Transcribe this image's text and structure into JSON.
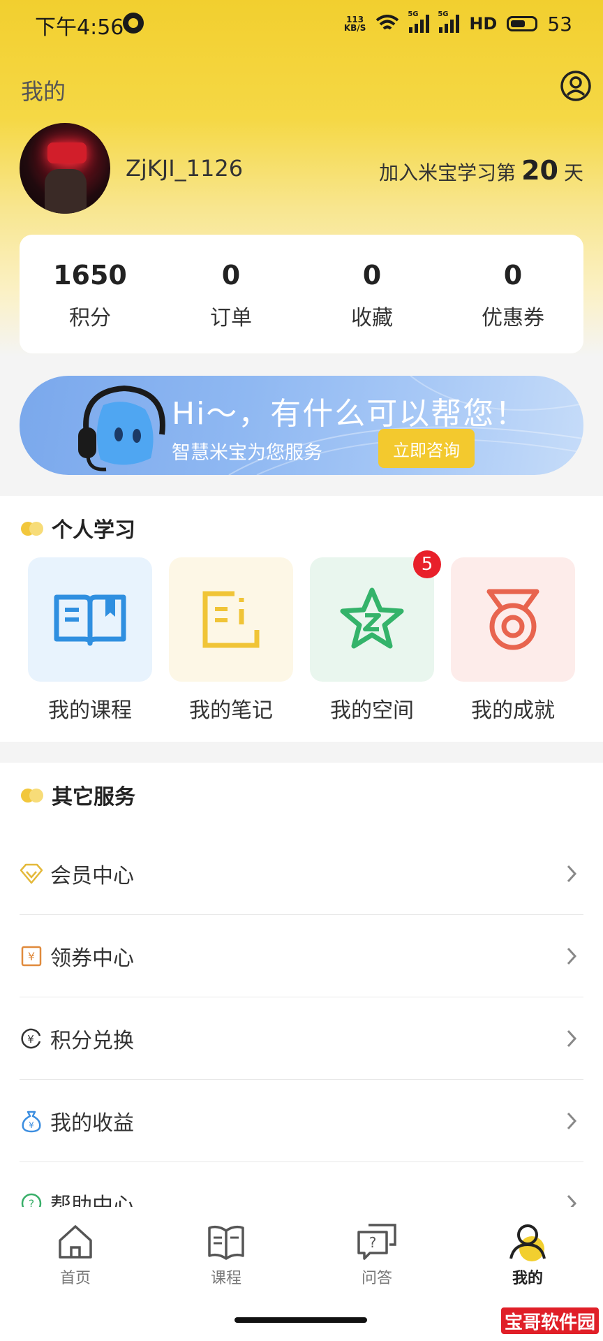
{
  "status_bar": {
    "time": "下午4:56",
    "net_speed_value": "113",
    "net_speed_unit": "KB/S",
    "signal1_label": "5G",
    "signal2_label": "5G",
    "hd_label": "HD",
    "battery": "53"
  },
  "header": {
    "title": "我的",
    "username": "ZjKJI_1126",
    "join_prefix": "加入米宝学习第",
    "join_days": "20",
    "join_suffix": "天"
  },
  "stats": [
    {
      "value": "1650",
      "label": "积分"
    },
    {
      "value": "0",
      "label": "订单"
    },
    {
      "value": "0",
      "label": "收藏"
    },
    {
      "value": "0",
      "label": "优惠券"
    }
  ],
  "banner": {
    "headline": "Hi～，有什么可以帮您！",
    "subtitle": "智慧米宝为您服务",
    "button": "立即咨询"
  },
  "learning": {
    "title": "个人学习",
    "items": [
      {
        "label": "我的课程",
        "icon": "book-icon",
        "color": "#2f8fe0"
      },
      {
        "label": "我的笔记",
        "icon": "note-icon",
        "color": "#f0c437"
      },
      {
        "label": "我的空间",
        "icon": "star-z-icon",
        "color": "#34b36a",
        "badge": "5"
      },
      {
        "label": "我的成就",
        "icon": "medal-icon",
        "color": "#e8644e"
      }
    ]
  },
  "services": {
    "title": "其它服务",
    "items": [
      {
        "label": "会员中心",
        "icon": "diamond-icon"
      },
      {
        "label": "领券中心",
        "icon": "coupon-icon"
      },
      {
        "label": "积分兑换",
        "icon": "exchange-icon"
      },
      {
        "label": "我的收益",
        "icon": "money-bag-icon"
      },
      {
        "label": "帮助中心",
        "icon": "help-icon"
      }
    ]
  },
  "tabbar": [
    {
      "label": "首页",
      "icon": "home-icon"
    },
    {
      "label": "课程",
      "icon": "book-tab-icon"
    },
    {
      "label": "问答",
      "icon": "qa-icon"
    },
    {
      "label": "我的",
      "icon": "user-tab-icon",
      "active": true
    }
  ],
  "watermark": "宝哥软件园",
  "colors": {
    "brand_yellow": "#f2cf2f",
    "badge_red": "#e8202a",
    "banner_blue": "#8fb8f2"
  }
}
